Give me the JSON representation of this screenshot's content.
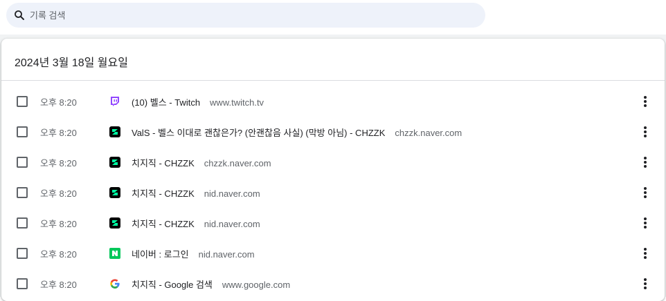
{
  "search": {
    "placeholder": "기록 검색"
  },
  "date_header": "2024년 3월 18일 월요일",
  "colors": {
    "search_bg": "#eef2fa",
    "twitch": "#9146ff",
    "chzzk_bg": "#000000",
    "chzzk_fg": "#00ffa3",
    "naver": "#03c75a"
  },
  "rows": [
    {
      "time": "오후 8:20",
      "title": "(10) 벨스 - Twitch",
      "domain": "www.twitch.tv",
      "icon": "twitch-icon"
    },
    {
      "time": "오후 8:20",
      "title": "ValS - 벨스 이대로 괜찮은가? (안괜찮음 사실) (막방 아님) - CHZZK",
      "domain": "chzzk.naver.com",
      "icon": "chzzk-icon"
    },
    {
      "time": "오후 8:20",
      "title": "치지직 - CHZZK",
      "domain": "chzzk.naver.com",
      "icon": "chzzk-icon"
    },
    {
      "time": "오후 8:20",
      "title": "치지직 - CHZZK",
      "domain": "nid.naver.com",
      "icon": "chzzk-icon"
    },
    {
      "time": "오후 8:20",
      "title": "치지직 - CHZZK",
      "domain": "nid.naver.com",
      "icon": "chzzk-icon"
    },
    {
      "time": "오후 8:20",
      "title": "네이버 : 로그인",
      "domain": "nid.naver.com",
      "icon": "naver-icon"
    },
    {
      "time": "오후 8:20",
      "title": "치지직 - Google 검색",
      "domain": "www.google.com",
      "icon": "google-icon"
    }
  ]
}
